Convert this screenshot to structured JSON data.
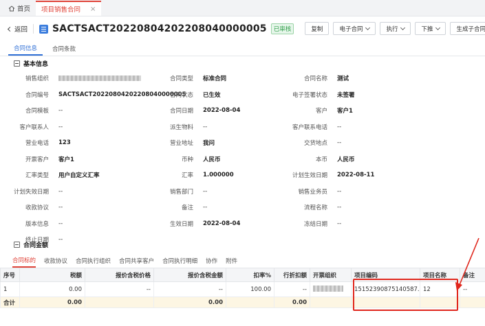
{
  "tabs": {
    "home": "首页",
    "current": "项目销售合同",
    "close": "×"
  },
  "header": {
    "back": "返回",
    "title": "SACTSACT20220804202208040000005",
    "status": "已审核",
    "actions": [
      "复制",
      "电子合同",
      "执行",
      "下推",
      "生成子合同"
    ]
  },
  "subtabs": [
    "合同信息",
    "合同条款"
  ],
  "section_basic": "基本信息",
  "section_amount": "合同金额",
  "fields": [
    {
      "label": "销售组织",
      "value": "",
      "blur": true
    },
    {
      "label": "合同类型",
      "value": "标准合同",
      "bold": true
    },
    {
      "label": "合同名称",
      "value": "测试",
      "bold": true
    },
    {
      "label": "合同编号",
      "value": "SACTSACT20220804202208040000005",
      "bold": true
    },
    {
      "label": "合同状态",
      "value": "已生效",
      "bold": true
    },
    {
      "label": "电子签署状态",
      "value": "未签署",
      "bold": true
    },
    {
      "label": "合同模板",
      "value": "--"
    },
    {
      "label": "合同日期",
      "value": "2022-08-04",
      "bold": true
    },
    {
      "label": "客户",
      "value": "客户1",
      "bold": true
    },
    {
      "label": "客户联系人",
      "value": "--"
    },
    {
      "label": "派生物料",
      "value": "--"
    },
    {
      "label": "客户联系电话",
      "value": "--"
    },
    {
      "label": "营业电话",
      "value": "123",
      "bold": true
    },
    {
      "label": "营业地址",
      "value": "我问",
      "bold": true
    },
    {
      "label": "交货地点",
      "value": "--"
    },
    {
      "label": "开票客户",
      "value": "客户1",
      "bold": true
    },
    {
      "label": "币种",
      "value": "人民币",
      "bold": true
    },
    {
      "label": "本币",
      "value": "人民币",
      "bold": true
    },
    {
      "label": "汇率类型",
      "value": "用户自定义汇率",
      "bold": true
    },
    {
      "label": "汇率",
      "value": "1.000000",
      "bold": true
    },
    {
      "label": "计划生效日期",
      "value": "2022-08-11",
      "bold": true
    },
    {
      "label": "计划失效日期",
      "value": "--"
    },
    {
      "label": "销售部门",
      "value": "--"
    },
    {
      "label": "销售业务员",
      "value": "--"
    },
    {
      "label": "收款协议",
      "value": "--"
    },
    {
      "label": "备注",
      "value": "--"
    },
    {
      "label": "流程名称",
      "value": "--"
    },
    {
      "label": "版本信息",
      "value": "--"
    },
    {
      "label": "生效日期",
      "value": "2022-08-04",
      "bold": true
    },
    {
      "label": "冻结日期",
      "value": "--"
    },
    {
      "label": "终止日期",
      "value": "--"
    }
  ],
  "bottom_tabs": [
    "合同标的",
    "收款协议",
    "合同执行组织",
    "合同共享客户",
    "合同执行明细",
    "协作",
    "附件"
  ],
  "table": {
    "headers": [
      "序号",
      "税额",
      "报价含税价格",
      "报价含税金额",
      "扣率%",
      "行折扣额",
      "开票组织",
      "项目编码",
      "项目名称",
      "备注"
    ],
    "row": [
      "1",
      "0.00",
      "--",
      "--",
      "100.00",
      "--",
      "",
      "15152390875140587...",
      "12",
      "--"
    ],
    "sum": [
      "合计",
      "0.00",
      "",
      "0.00",
      "",
      "0.00",
      "",
      "",
      "",
      ""
    ]
  }
}
